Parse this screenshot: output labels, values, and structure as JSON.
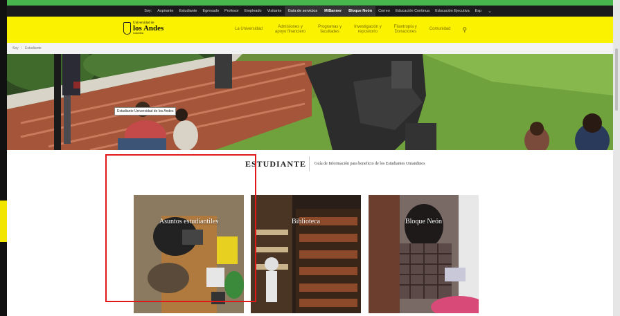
{
  "topbar": {
    "links": [
      "Soy:",
      "Aspirante",
      "Estudiante",
      "Egresado",
      "Profesor",
      "Empleado",
      "Visitante",
      "Guía de servicios"
    ],
    "mibanner": "MiBanner",
    "bloque_neon": "Bloque Neón",
    "links2": [
      "Correo",
      "Educación Continua",
      "Educación Ejecutiva",
      "Esp"
    ]
  },
  "logo": {
    "line1": "Universidad de",
    "line2": "los Andes",
    "line3": "Colombia"
  },
  "nav": {
    "items": [
      "La Universidad",
      "Admisiones y\napoyo financiero",
      "Programas y\nfacultades",
      "Investigación y\nrepositorio",
      "Filantropía y\nDonaciones",
      "Comunidad"
    ]
  },
  "breadcrumb": [
    "Soy",
    "Estudiante"
  ],
  "hero": {
    "tooltip": "Estudiante Universidad de los Andes"
  },
  "section": {
    "title": "ESTUDIANTE",
    "subtitle": "Guía de Información para beneficio de los Estudiantes Uniandinos"
  },
  "cards": [
    {
      "label": "Asuntos estudiantiles"
    },
    {
      "label": "Biblioteca"
    },
    {
      "label": "Bloque Neón"
    }
  ],
  "colors": {
    "brand_yellow": "#fbf200",
    "topbar": "#1b1b1b",
    "highlight_box": "#e01818"
  }
}
